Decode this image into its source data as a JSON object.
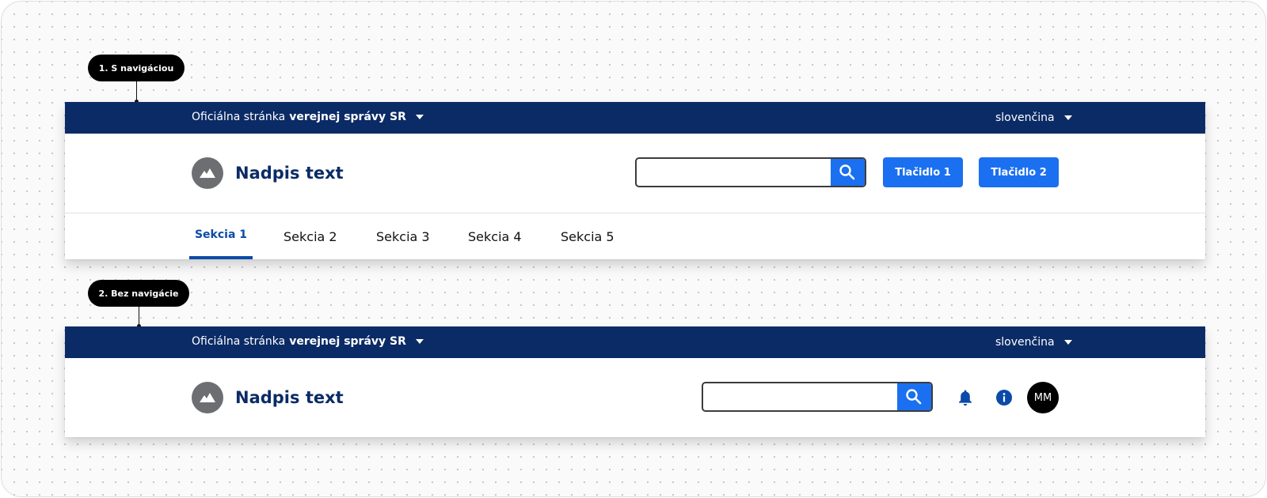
{
  "colors": {
    "gov_bar": "#0b2b66",
    "primary": "#1a70f0",
    "title": "#0b2b66",
    "nav_active": "#0b4aa8"
  },
  "example1": {
    "tag": "1. S navigáciou",
    "gov_bar": {
      "prefix": "Oficiálna stránka",
      "bold": "verejnej správy SR",
      "language": "slovenčina"
    },
    "logo_icon": "mountain-image-icon",
    "title": "Nadpis text",
    "search": {
      "value": "",
      "placeholder": "",
      "icon": "search-icon"
    },
    "buttons": [
      "Tlačidlo 1",
      "Tlačidlo 2"
    ],
    "nav": {
      "active_index": 0,
      "items": [
        "Sekcia 1",
        "Sekcia 2",
        "Sekcia 3",
        "Sekcia 4",
        "Sekcia 5"
      ]
    }
  },
  "example2": {
    "tag": "2. Bez navigácie",
    "gov_bar": {
      "prefix": "Oficiálna stránka",
      "bold": "verejnej správy SR",
      "language": "slovenčina"
    },
    "logo_icon": "mountain-image-icon",
    "title": "Nadpis text",
    "search": {
      "value": "",
      "placeholder": "",
      "icon": "search-icon"
    },
    "icons": [
      "bell-icon",
      "info-icon"
    ],
    "avatar": "MM"
  }
}
